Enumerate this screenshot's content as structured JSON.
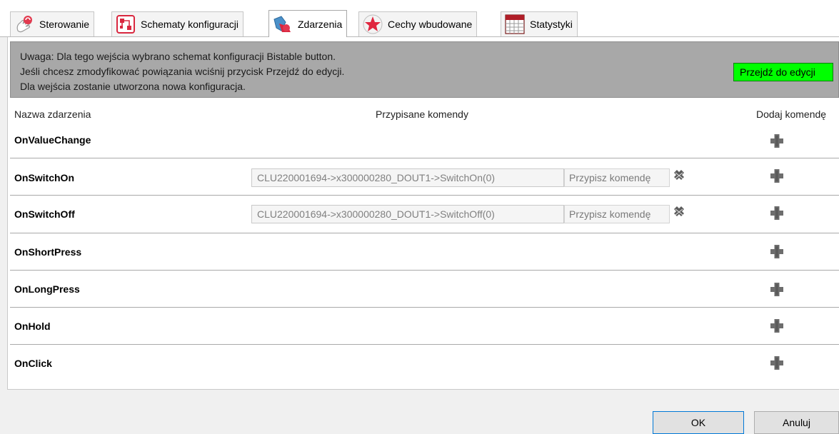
{
  "tabs": [
    {
      "label": "Sterowanie",
      "icon": "hand-pointer-icon"
    },
    {
      "label": "Schematy konfiguracji",
      "icon": "schema-icon"
    },
    {
      "label": "Zdarzenia",
      "icon": "events-icon",
      "active": true
    },
    {
      "label": "Cechy wbudowane",
      "icon": "star-icon"
    },
    {
      "label": "Statystyki",
      "icon": "calendar-grid-icon"
    }
  ],
  "notice": {
    "line1": "Uwaga: Dla tego wejścia wybrano schemat konfiguracji Bistable button.",
    "line2": "Jeśli chcesz zmodyfikować powiązania wciśnij przycisk Przejdź do edycji.",
    "line3": "Dla wejścia zostanie utworzona nowa konfiguracja.",
    "edit_button": "Przejdź do edycji"
  },
  "headers": {
    "event_name": "Nazwa zdarzenia",
    "assigned_commands": "Przypisane komendy",
    "add_command": "Dodaj komendę"
  },
  "events": [
    {
      "name": "OnValueChange"
    },
    {
      "name": "OnSwitchOn",
      "command": "CLU220001694->x300000280_DOUT1->SwitchOn(0)",
      "assign": "Przypisz komendę"
    },
    {
      "name": "OnSwitchOff",
      "command": "CLU220001694->x300000280_DOUT1->SwitchOff(0)",
      "assign": "Przypisz komendę"
    },
    {
      "name": "OnShortPress"
    },
    {
      "name": "OnLongPress"
    },
    {
      "name": "OnHold"
    },
    {
      "name": "OnClick"
    }
  ],
  "buttons": {
    "ok": "OK",
    "cancel": "Anuluj"
  },
  "colors": {
    "edit_button_bg": "#00ff00",
    "notice_bg": "#a8a8a8",
    "accent_red": "#d9273f"
  }
}
